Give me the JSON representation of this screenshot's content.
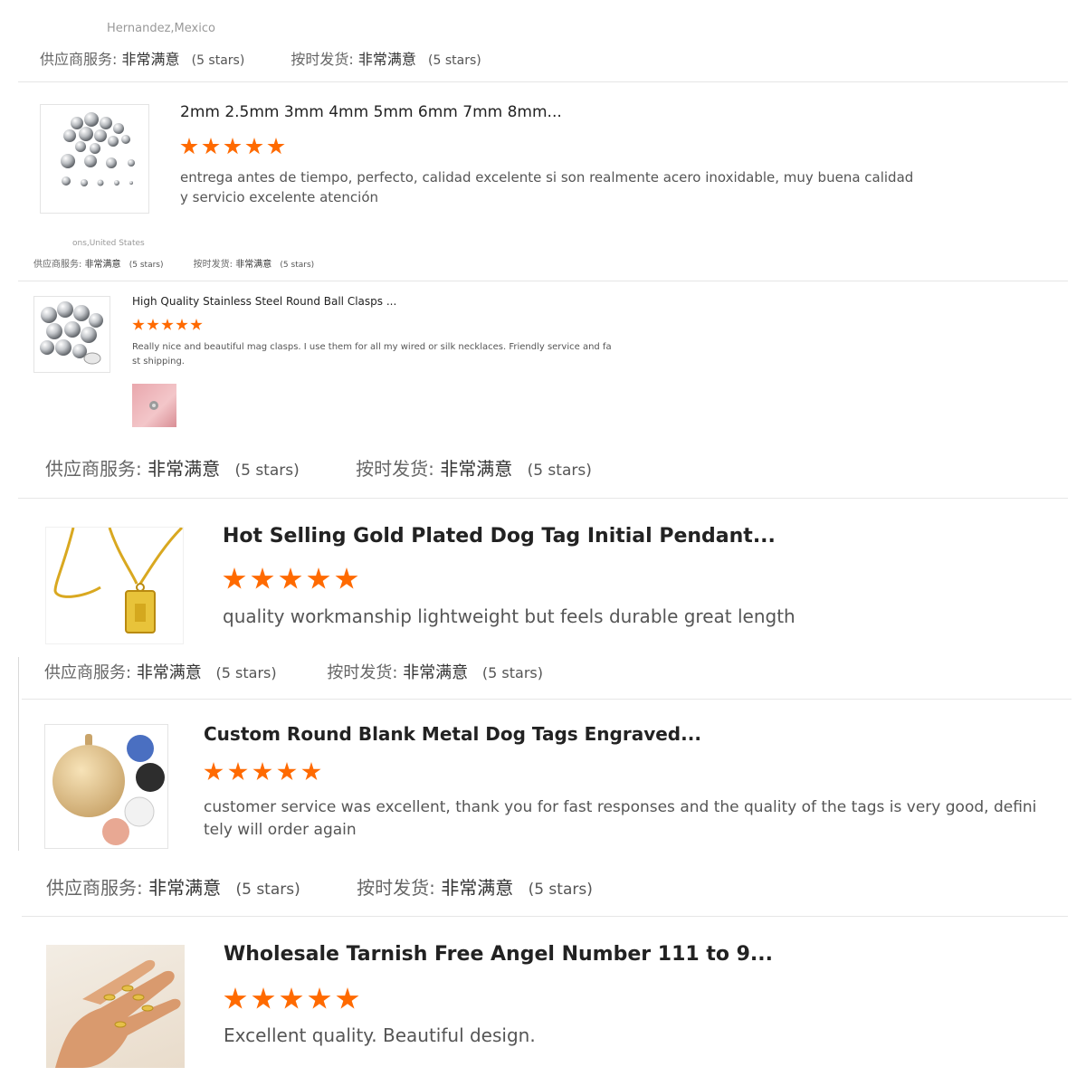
{
  "labels": {
    "supplier_service": "供应商服务:",
    "on_time_shipping": "按时发货:",
    "rating_text": "非常满意",
    "stars_text": "(5 stars)"
  },
  "reviews": [
    {
      "reviewer": "Hernandez,Mexico",
      "title": "2mm 2.5mm 3mm 4mm 5mm 6mm 7mm 8mm...",
      "rating": 5,
      "text_line1": "entrega antes de tiempo, perfecto, calidad excelente si son realmente acero inoxidable, muy buena calidad",
      "text_line2": "y servicio excelente atención",
      "thumb_icon": "steel-beads-image"
    },
    {
      "reviewer": "ons,United States",
      "title": "High Quality Stainless Steel Round Ball Clasps ...",
      "rating": 5,
      "text_line1": "Really nice and beautiful mag clasps.  I use them for all my wired or silk necklaces.  Friendly service and fa",
      "text_line2": "st shipping.",
      "thumb_icon": "ball-clasps-image",
      "attachment_icon": "review-photo-thumbnail"
    },
    {
      "title": "Hot Selling Gold Plated Dog Tag Initial Pendant...",
      "rating": 5,
      "text_line1": "quality workmanship lightweight but feels durable great length",
      "thumb_icon": "gold-pendant-image"
    },
    {
      "title": "Custom Round Blank Metal Dog Tags Engraved...",
      "rating": 5,
      "text_line1": "customer service was excellent, thank you for fast responses and the quality of the tags is very good, defini",
      "text_line2": "tely will order again",
      "thumb_icon": "dog-tags-image"
    },
    {
      "title": "Wholesale Tarnish Free Angel Number 111 to 9...",
      "rating": 5,
      "text_line1": "Excellent quality. Beautiful design.",
      "thumb_icon": "rings-hand-image"
    }
  ],
  "colors": {
    "star": "#ff6a00",
    "divider": "#e6e6e6"
  }
}
